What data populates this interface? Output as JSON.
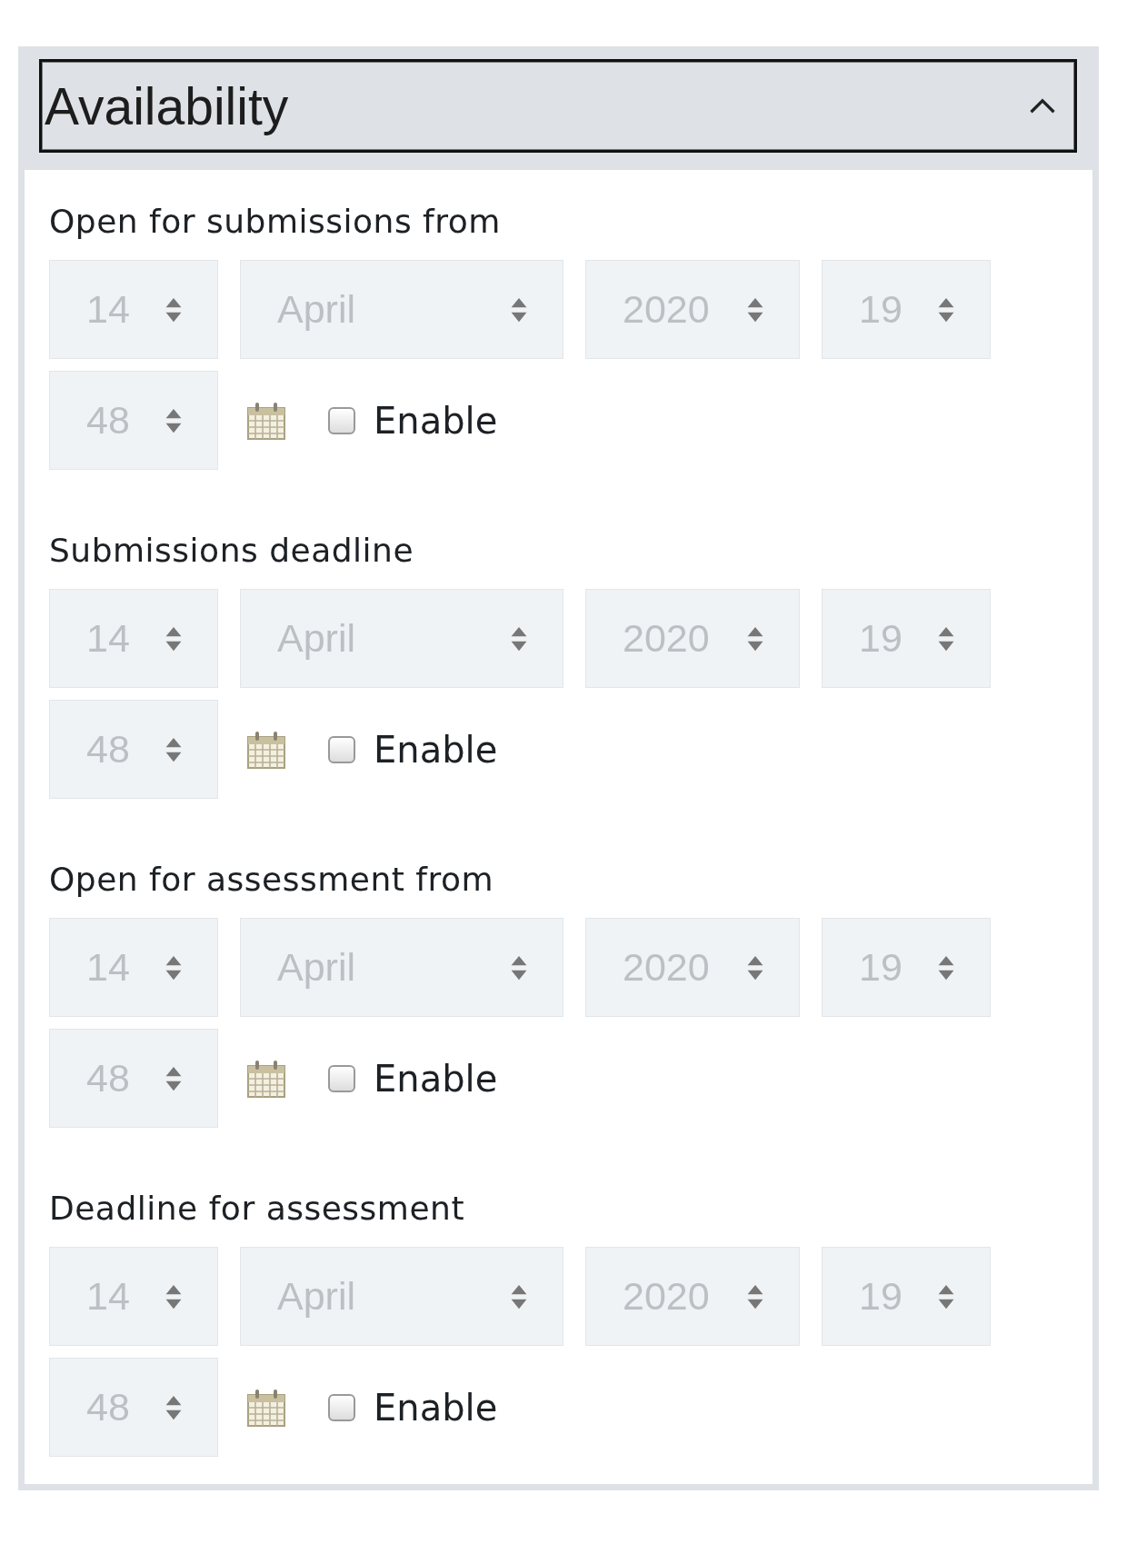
{
  "section": {
    "title": "Availability",
    "expanded": true
  },
  "groups": [
    {
      "label": "Open for submissions from",
      "fields": [
        "14",
        "April",
        "2020",
        "19",
        "48"
      ],
      "checkbox": {
        "label": "Enable",
        "checked": false
      }
    },
    {
      "label": "Submissions deadline",
      "fields": [
        "14",
        "April",
        "2020",
        "19",
        "48"
      ],
      "checkbox": {
        "label": "Enable",
        "checked": false
      }
    },
    {
      "label": "Open for assessment from",
      "fields": [
        "14",
        "April",
        "2020",
        "19",
        "48"
      ],
      "checkbox": {
        "label": "Enable",
        "checked": false
      }
    },
    {
      "label": "Deadline for assessment",
      "fields": [
        "14",
        "April",
        "2020",
        "19",
        "48"
      ],
      "checkbox": {
        "label": "Enable",
        "checked": false
      }
    }
  ]
}
